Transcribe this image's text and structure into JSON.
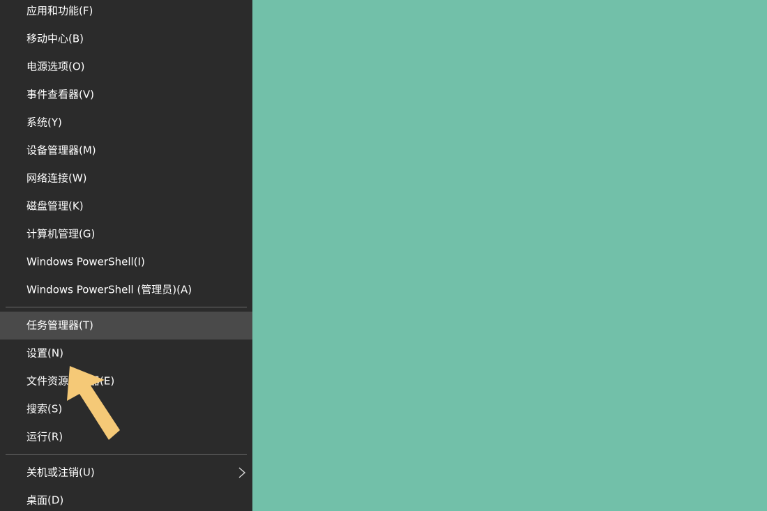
{
  "menu": {
    "items": [
      {
        "label": "应用和功能(F)"
      },
      {
        "label": "移动中心(B)"
      },
      {
        "label": "电源选项(O)"
      },
      {
        "label": "事件查看器(V)"
      },
      {
        "label": "系统(Y)"
      },
      {
        "label": "设备管理器(M)"
      },
      {
        "label": "网络连接(W)"
      },
      {
        "label": "磁盘管理(K)"
      },
      {
        "label": "计算机管理(G)"
      },
      {
        "label": "Windows PowerShell(I)"
      },
      {
        "label": "Windows PowerShell (管理员)(A)"
      },
      {
        "label": "任务管理器(T)"
      },
      {
        "label": "设置(N)"
      },
      {
        "label": "文件资源管理器(E)"
      },
      {
        "label": "搜索(S)"
      },
      {
        "label": "运行(R)"
      },
      {
        "label": "关机或注销(U)"
      },
      {
        "label": "桌面(D)"
      }
    ],
    "highlighted_item": "任务管理器(T)",
    "submenu_indicator_icon": "chevron-right-icon"
  },
  "annotation": {
    "icon": "pointing-arrow-icon",
    "color": "#f5c977"
  },
  "colors": {
    "menu_background": "#2b2b2b",
    "menu_highlight": "#4a4a4a",
    "separator": "#6b6b6b",
    "desktop_background": "#72c0a9",
    "text": "#ffffff"
  }
}
